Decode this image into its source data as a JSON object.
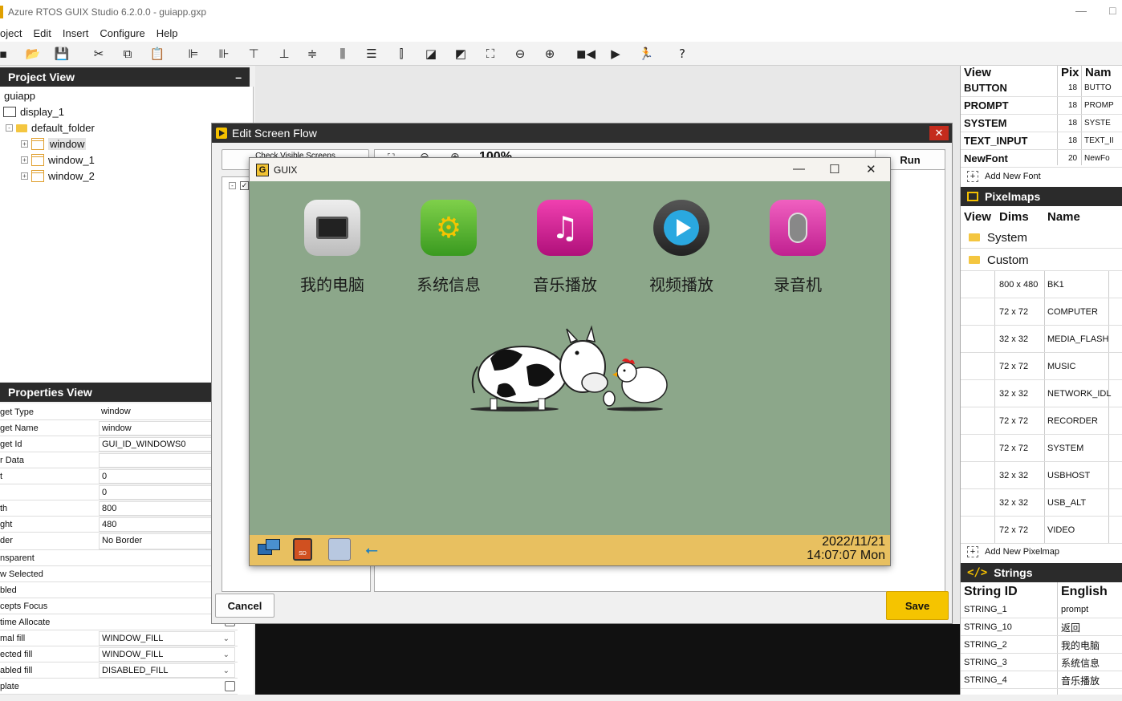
{
  "app": {
    "title": "Azure RTOS GUIX Studio 6.2.0.0 - guiapp.gxp",
    "minimize": "—",
    "maximize": "□"
  },
  "menu": [
    "oject",
    "Edit",
    "Insert",
    "Configure",
    "Help"
  ],
  "project_view": {
    "title": "Project View",
    "collapse": "–",
    "root": "guiapp",
    "display": "display_1",
    "folder": "default_folder",
    "windows": [
      "window",
      "window_1",
      "window_2"
    ]
  },
  "properties_view": {
    "title": "Properties View",
    "rows": [
      {
        "label": "get Type",
        "value": "window"
      },
      {
        "label": "get Name",
        "value": "window"
      },
      {
        "label": "get Id",
        "value": "GUI_ID_WINDOWS0"
      },
      {
        "label": "r Data",
        "value": ""
      },
      {
        "label": "t",
        "value": "0"
      },
      {
        "label": "",
        "value": "0"
      },
      {
        "label": "th",
        "value": "800"
      },
      {
        "label": "ght",
        "value": "480"
      },
      {
        "label": "der",
        "value": "No Border"
      }
    ],
    "check_rows": [
      "nsparent",
      "w Selected",
      "bled",
      "cepts Focus",
      "time Allocate"
    ],
    "fill_rows": [
      {
        "label": "mal fill",
        "value": "WINDOW_FILL"
      },
      {
        "label": "ected fill",
        "value": "WINDOW_FILL"
      },
      {
        "label": "abled fill",
        "value": "DISABLED_FILL"
      }
    ],
    "template_label": "plate"
  },
  "screen_flow": {
    "title": "Edit Screen Flow",
    "check_visible": "Check Visible Screens",
    "zoom": "100%",
    "run": "Run",
    "cancel": "Cancel",
    "save": "Save",
    "close": "✕"
  },
  "guix_window": {
    "title": "GUIX",
    "icon_letter": "G",
    "apps": [
      "我的电脑",
      "系统信息",
      "音乐播放",
      "视频播放",
      "录音机"
    ],
    "date": "2022/11/21",
    "time": "14:07:07 Mon",
    "minimize": "—",
    "maximize": "☐",
    "close": "✕"
  },
  "fonts_panel": {
    "headers": [
      "View",
      "Pix",
      "Nam"
    ],
    "rows": [
      {
        "name": "BUTTON",
        "pix": "18",
        "short": "BUTTO"
      },
      {
        "name": "PROMPT",
        "pix": "18",
        "short": "PROMP"
      },
      {
        "name": "SYSTEM",
        "pix": "18",
        "short": "SYSTE"
      },
      {
        "name": "TEXT_INPUT",
        "pix": "18",
        "short": "TEXT_II"
      },
      {
        "name": "NewFont",
        "pix": "20",
        "short": "NewFo"
      }
    ],
    "add_label": "Add New Font"
  },
  "pixelmaps_panel": {
    "title": "Pixelmaps",
    "headers": [
      "View",
      "Dims",
      "Name"
    ],
    "folders": [
      "System",
      "Custom"
    ],
    "rows": [
      {
        "dims": "800 x 480",
        "name": "BK1"
      },
      {
        "dims": "72 x 72",
        "name": "COMPUTER"
      },
      {
        "dims": "32 x 32",
        "name": "MEDIA_FLASH"
      },
      {
        "dims": "72 x 72",
        "name": "MUSIC"
      },
      {
        "dims": "32 x 32",
        "name": "NETWORK_IDL"
      },
      {
        "dims": "72 x 72",
        "name": "RECORDER"
      },
      {
        "dims": "72 x 72",
        "name": "SYSTEM"
      },
      {
        "dims": "32 x 32",
        "name": "USBHOST"
      },
      {
        "dims": "32 x 32",
        "name": "USB_ALT"
      },
      {
        "dims": "72 x 72",
        "name": "VIDEO"
      }
    ],
    "add_label": "Add New Pixelmap"
  },
  "strings_panel": {
    "title": "Strings",
    "headers": [
      "String ID",
      "English"
    ],
    "rows": [
      {
        "id": "STRING_1",
        "text": "prompt"
      },
      {
        "id": "STRING_10",
        "text": "返回"
      },
      {
        "id": "STRING_2",
        "text": "我的电脑"
      },
      {
        "id": "STRING_3",
        "text": "系统信息"
      },
      {
        "id": "STRING_4",
        "text": "音乐播放"
      }
    ]
  },
  "colors": {
    "screen_bg": "#8ca78a",
    "status_bar": "#e8c060",
    "accent": "#f5c400",
    "panel_header": "#2b2b2b"
  }
}
